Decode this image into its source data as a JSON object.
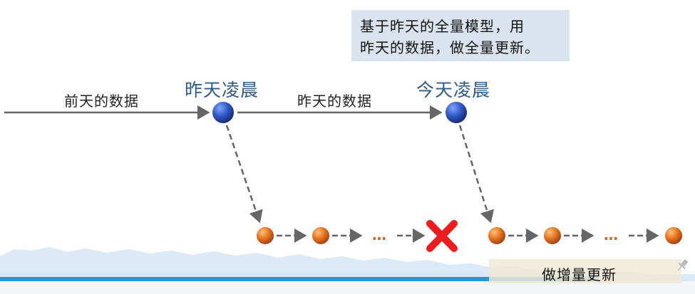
{
  "note": {
    "line1": "基于昨天的全量模型，用",
    "line2": "昨天的数据，做全量更新。"
  },
  "edges": {
    "day_before_data": "前天的数据",
    "yesterday_data": "昨天的数据"
  },
  "nodes": {
    "yesterday_dawn": "昨天凌晨",
    "today_dawn": "今天凌晨"
  },
  "dots_left": "…",
  "dots_right": "…",
  "footer": {
    "incremental_update": "做增量更新"
  },
  "colors": {
    "blue_node": "#2f57c6",
    "orange_node": "#e5741f",
    "arrow": "#666666",
    "cross": "#ee1c1c",
    "label_blue": "#2e5b8a",
    "note_bg": "#dbe4ee"
  },
  "icons": {
    "failure_mark": "cross-icon"
  }
}
